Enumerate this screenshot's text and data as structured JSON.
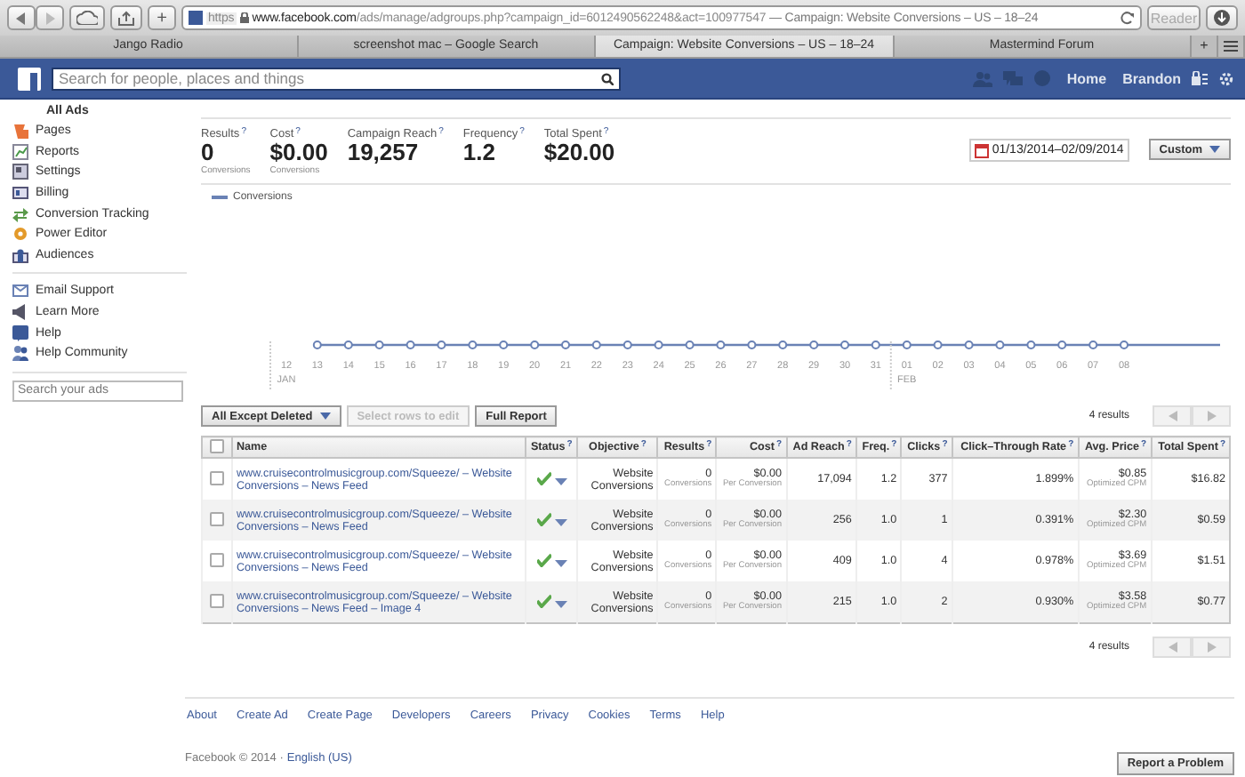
{
  "browser": {
    "url": {
      "scheme": "https",
      "host": "www.facebook.com",
      "path": "/ads/manage/adgroups.php?campaign_id=6012490562248&act=100977547",
      "title": "— Campaign: Website Conversions – US – 18–24"
    },
    "reader": "Reader",
    "new_tab": "+",
    "tabs": [
      {
        "label": "Jango Radio",
        "selected": false
      },
      {
        "label": "screenshot mac – Google Search",
        "selected": false
      },
      {
        "label": "Campaign: Website Conversions – US – 18–24",
        "selected": true
      },
      {
        "label": "Mastermind Forum",
        "selected": false
      }
    ]
  },
  "top_bar": {
    "search_placeholder": "Search for people, places and things",
    "nav": [
      "Home",
      "Brandon"
    ]
  },
  "sidebar": {
    "header": "All Ads",
    "items": [
      {
        "label": "Pages"
      },
      {
        "label": "Reports"
      },
      {
        "label": "Settings"
      },
      {
        "label": "Billing"
      },
      {
        "label": "Conversion Tracking"
      },
      {
        "label": "Power Editor"
      },
      {
        "label": "Audiences"
      }
    ],
    "help_items": [
      {
        "label": "Email Support"
      },
      {
        "label": "Learn More"
      },
      {
        "label": "Help"
      },
      {
        "label": "Help Community"
      }
    ],
    "search_placeholder": "Search your ads"
  },
  "stats": [
    {
      "label": "Results",
      "hint": "?",
      "value": "0",
      "sub": "Conversions"
    },
    {
      "label": "Cost",
      "hint": "?",
      "value": "$0.00",
      "sub": "Conversions"
    },
    {
      "label": "Campaign Reach",
      "hint": "?",
      "value": "19,257"
    },
    {
      "label": "Frequency",
      "hint": "?",
      "value": "1.2"
    },
    {
      "label": "Total Spent",
      "hint": "?",
      "value": "$20.00"
    }
  ],
  "date_range": {
    "value": "01/13/2014–02/09/2014",
    "button": "Custom"
  },
  "chart": {
    "legend": "Conversions",
    "x_labels": [
      {
        "day": "12",
        "month": "JAN"
      },
      {
        "day": "13"
      },
      {
        "day": "14"
      },
      {
        "day": "15"
      },
      {
        "day": "16"
      },
      {
        "day": "17"
      },
      {
        "day": "18"
      },
      {
        "day": "19"
      },
      {
        "day": "20"
      },
      {
        "day": "21"
      },
      {
        "day": "22"
      },
      {
        "day": "23"
      },
      {
        "day": "24"
      },
      {
        "day": "25"
      },
      {
        "day": "26"
      },
      {
        "day": "27"
      },
      {
        "day": "28"
      },
      {
        "day": "29"
      },
      {
        "day": "30"
      },
      {
        "day": "31"
      },
      {
        "day": "01",
        "month": "FEB"
      },
      {
        "day": "02"
      },
      {
        "day": "03"
      },
      {
        "day": "04"
      },
      {
        "day": "05"
      },
      {
        "day": "06"
      },
      {
        "day": "07"
      },
      {
        "day": "08"
      }
    ]
  },
  "toolbar": {
    "filter": "All Except Deleted",
    "edit": {
      "label": "Select rows to edit",
      "disabled": true
    },
    "report": "Full Report",
    "results": "4 results"
  },
  "table": {
    "all_checked": false,
    "columns": [
      {
        "label": "Name"
      },
      {
        "label": "Status",
        "hint": "?"
      },
      {
        "label": "Objective",
        "hint": "?"
      },
      {
        "label": "Results",
        "hint": "?"
      },
      {
        "label": "Cost",
        "hint": "?"
      },
      {
        "label": "Ad Reach",
        "hint": "?"
      },
      {
        "label": "Freq.",
        "hint": "?"
      },
      {
        "label": "Clicks",
        "hint": "?"
      },
      {
        "label": "Click–Through Rate",
        "hint": "?"
      },
      {
        "label": "Avg. Price",
        "hint": "?"
      },
      {
        "label": "Total Spent",
        "hint": "?"
      }
    ],
    "rows": [
      {
        "checked": false,
        "name": "www.cruisecontrolmusicgroup.com/Squeeze/ – Website Conversions – News Feed",
        "active": true,
        "objective": "Website Conversions",
        "results": "0",
        "results_sub": "Conversions",
        "cost": "$0.00",
        "cost_sub": "Per Conversion",
        "reach": "17,094",
        "freq": "1.2",
        "clicks": "377",
        "ctr": "1.899%",
        "price": "$0.85",
        "price_sub": "Optimized CPM",
        "spent": "$16.82"
      },
      {
        "checked": false,
        "name": "www.cruisecontrolmusicgroup.com/Squeeze/ – Website Conversions – News Feed",
        "active": true,
        "objective": "Website Conversions",
        "results": "0",
        "results_sub": "Conversions",
        "cost": "$0.00",
        "cost_sub": "Per Conversion",
        "reach": "256",
        "freq": "1.0",
        "clicks": "1",
        "ctr": "0.391%",
        "price": "$2.30",
        "price_sub": "Optimized CPM",
        "spent": "$0.59"
      },
      {
        "checked": false,
        "name": "www.cruisecontrolmusicgroup.com/Squeeze/ – Website Conversions – News Feed",
        "active": true,
        "objective": "Website Conversions",
        "results": "0",
        "results_sub": "Conversions",
        "cost": "$0.00",
        "cost_sub": "Per Conversion",
        "reach": "409",
        "freq": "1.0",
        "clicks": "4",
        "ctr": "0.978%",
        "price": "$3.69",
        "price_sub": "Optimized CPM",
        "spent": "$1.51"
      },
      {
        "checked": false,
        "name": "www.cruisecontrolmusicgroup.com/Squeeze/ – Website Conversions – News Feed – Image 4",
        "active": true,
        "objective": "Website Conversions",
        "results": "0",
        "results_sub": "Conversions",
        "cost": "$0.00",
        "cost_sub": "Per Conversion",
        "reach": "215",
        "freq": "1.0",
        "clicks": "2",
        "ctr": "0.930%",
        "price": "$3.58",
        "price_sub": "Optimized CPM",
        "spent": "$0.77"
      }
    ],
    "results": "4 results"
  },
  "footer": {
    "links": [
      "About",
      "Create Ad",
      "Create Page",
      "Developers",
      "Careers",
      "Privacy",
      "Cookies",
      "Terms",
      "Help"
    ],
    "copyright": "Facebook © 2014 ·",
    "language": "English (US)",
    "report": "Report a Problem"
  }
}
